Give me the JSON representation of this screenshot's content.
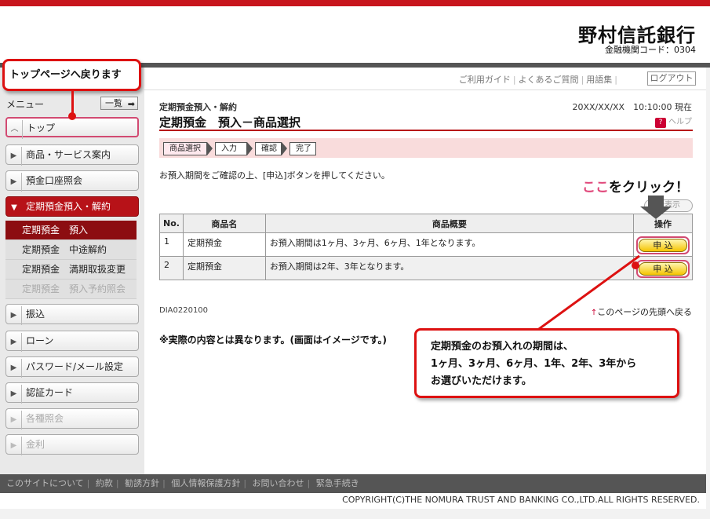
{
  "header": {
    "bank_name": "野村信託銀行",
    "bank_code": "金融機関コード：0304"
  },
  "util_links": {
    "guide": "ご利用ガイド",
    "faq": "よくあるご質問",
    "glossary": "用語集",
    "logout": "ログアウト"
  },
  "sidebar": {
    "menu_label": "メニュー",
    "list_button": "一覧",
    "items": [
      {
        "label": "トップ"
      },
      {
        "label": "商品・サービス案内"
      },
      {
        "label": "預金口座照会"
      },
      {
        "label": "定期預金預入・解約"
      },
      {
        "label": "振込"
      },
      {
        "label": "ローン"
      },
      {
        "label": "パスワード/メール設定"
      },
      {
        "label": "認証カード"
      },
      {
        "label": "各種照会"
      },
      {
        "label": "金利"
      }
    ],
    "sub_items": [
      {
        "label": "定期預金　預入"
      },
      {
        "label": "定期預金　中途解約"
      },
      {
        "label": "定期預金　満期取扱変更"
      },
      {
        "label": "定期預金　預入予約照会"
      }
    ]
  },
  "main": {
    "breadcrumb": "定期預金預入・解約",
    "datetime": "20XX/XX/XX　10:10:00 現在",
    "title": "定期預金　預入－商品選択",
    "help": "ヘルプ",
    "steps": [
      "商品選択",
      "入力",
      "確認",
      "完了"
    ],
    "instruction": "お預入期間をご確認の上、[申込]ボタンを押してください。",
    "show_all": "全表示",
    "table": {
      "headers": [
        "No.",
        "商品名",
        "商品概要",
        "操作"
      ],
      "rows": [
        {
          "no": "1",
          "name": "定期預金",
          "summary": "お預入期間は1ヶ月、3ヶ月、6ヶ月、1年となります。",
          "action": "申 込"
        },
        {
          "no": "2",
          "name": "定期預金",
          "summary": "お預入期間は2年、3年となります。",
          "action": "申 込"
        }
      ]
    },
    "page_id": "DIA0220100",
    "to_top": "このページの先頭へ戻る",
    "note": "※実際の内容とは異なります。(画面はイメージです。)"
  },
  "annotations": {
    "top_callout": "トップページへ戻ります",
    "click_here_pink": "ここ",
    "click_here_rest": "をクリック！",
    "period_line1": "定期預金のお預入れの期間は、",
    "period_line2": "1ヶ月、3ヶ月、6ヶ月、1年、2年、3年から",
    "period_line3": "お選びいただけます。"
  },
  "footer": {
    "links": [
      "このサイトについて",
      "約款",
      "勧誘方針",
      "個人情報保護方針",
      "お問い合わせ",
      "緊急手続き"
    ],
    "copyright": "COPYRIGHT(C)THE NOMURA TRUST AND BANKING CO.,LTD.ALL RIGHTS RESERVED."
  },
  "colors": {
    "brand_red": "#c8161d",
    "callout_red": "#dd1111",
    "highlight_pink": "#d24a72",
    "apply_yellow": "#f5c400"
  }
}
